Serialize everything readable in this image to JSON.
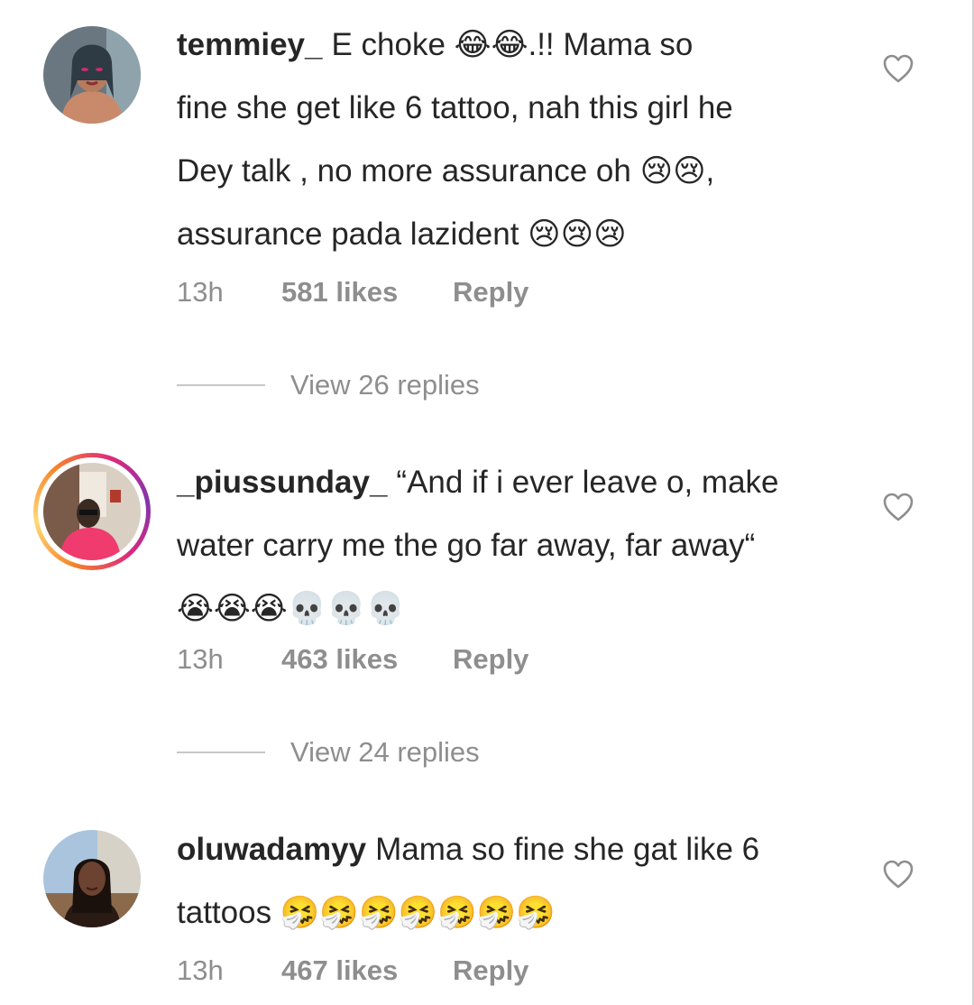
{
  "comments": [
    {
      "username": "temmiey_",
      "lines": [
        "E choke 😂😂.!! Mama so",
        "fine she get like 6 tattoo, nah this girl he",
        "Dey talk , no more assurance oh 😢😢,",
        "assurance pada lazident 😢😢😢"
      ],
      "time": "13h",
      "likes": "581 likes",
      "reply": "Reply",
      "view_replies": "View 26 replies",
      "has_story_ring": false
    },
    {
      "username": "_piussunday_",
      "lines": [
        "“And if i ever leave o, make",
        "water carry me the go far away, far away“",
        "😭😭😭💀💀💀"
      ],
      "time": "13h",
      "likes": "463 likes",
      "reply": "Reply",
      "view_replies": "View 24 replies",
      "has_story_ring": true
    },
    {
      "username": "oluwadamyy",
      "lines": [
        "Mama so fine she gat like 6",
        "tattoos 🤧🤧🤧🤧🤧🤧🤧"
      ],
      "time": "13h",
      "likes": "467 likes",
      "reply": "Reply",
      "has_story_ring": false
    }
  ],
  "icons": {
    "like": "heart-outline-icon"
  },
  "colors": {
    "text": "#262626",
    "secondary": "#8e8e8e",
    "divider": "#c7c7c7"
  }
}
